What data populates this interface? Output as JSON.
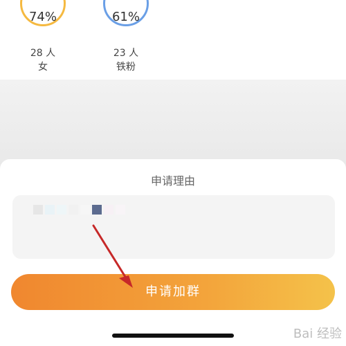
{
  "stats": [
    {
      "percent": "74%",
      "count": "28 人",
      "label": "女",
      "ring_color": "#f5b940"
    },
    {
      "percent": "61%",
      "count": "23 人",
      "label": "铁粉",
      "ring_color": "#6a9fe6"
    }
  ],
  "sheet": {
    "title": "申请理由",
    "reason_value": "",
    "submit_label": "申请加群"
  },
  "colors": {
    "button_start": "#f0872f",
    "button_end": "#f4c24a",
    "annotation_arrow": "#c62828"
  },
  "watermark": "Bai 经验"
}
